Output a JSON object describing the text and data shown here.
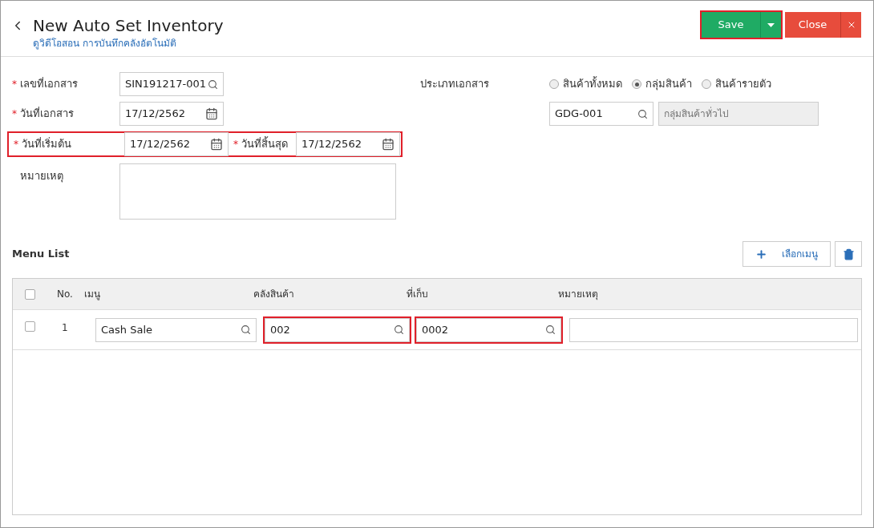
{
  "header": {
    "title": "New Auto Set Inventory",
    "subtitle": "ดูวิดีโอสอน การบันทึกคลังอัตโนมัติ",
    "save": {
      "label": "Save",
      "highlighted": true
    },
    "close": {
      "label": "Close"
    }
  },
  "form": {
    "doc_no": {
      "label": "เลขที่เอกสาร",
      "mark": "*",
      "value": "SIN191217-001"
    },
    "doc_date": {
      "label": "วันที่เอกสาร",
      "mark": "*",
      "value": "17/12/2562"
    },
    "date_range": {
      "highlighted": true,
      "start": {
        "label": "วันที่เริ่มต้น",
        "mark": "*",
        "value": "17/12/2562"
      },
      "end": {
        "label": "วันที่สิ้นสุด",
        "mark": "*",
        "value": "17/12/2562"
      }
    },
    "note": {
      "label": "หมายเหตุ"
    },
    "doc_type": {
      "label": "ประเภทเอกสาร",
      "options": [
        {
          "label": "สินค้าทั้งหมด",
          "selected": false
        },
        {
          "label": "กลุ่มสินค้า",
          "selected": true
        },
        {
          "label": "สินค้ารายตัว",
          "selected": false
        }
      ]
    },
    "group_code": {
      "value": "GDG-001"
    },
    "group_name": {
      "placeholder": "กลุ่มสินค้าทั่วไป"
    }
  },
  "menu_list": {
    "title": "Menu List",
    "add_button": "เลือกเมนู",
    "select_all_checked": false,
    "columns": [
      "No.",
      "เมนู",
      "คลังสินค้า",
      "ที่เก็บ",
      "หมายเหตุ"
    ],
    "rows": [
      {
        "checked": false,
        "no": "1",
        "menu": {
          "value": "Cash Sale",
          "highlighted": false
        },
        "warehouse": {
          "value": "002",
          "highlighted": true
        },
        "location": {
          "value": "0002",
          "highlighted": true
        }
      }
    ]
  }
}
